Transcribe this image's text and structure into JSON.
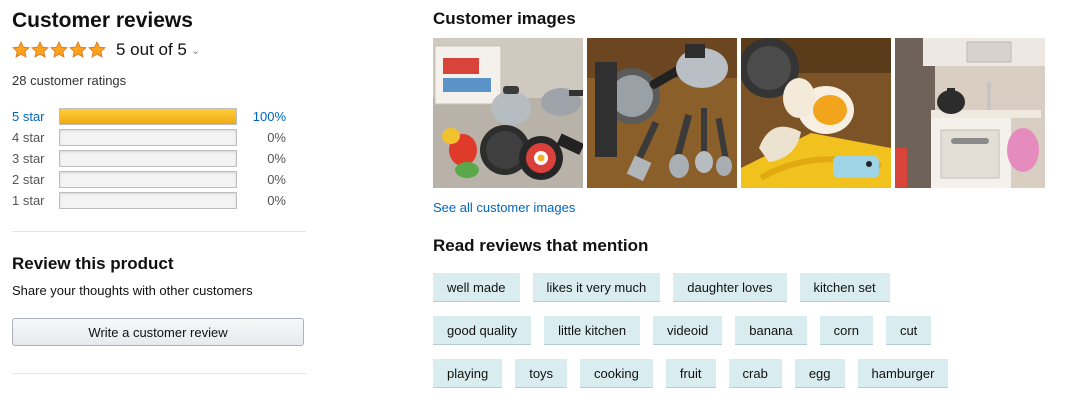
{
  "reviews": {
    "title": "Customer reviews",
    "rating_value": 5,
    "rating_text": "5 out of 5",
    "total_ratings": "28 customer ratings",
    "histogram": [
      {
        "label": "5 star",
        "percent_text": "100%",
        "percent": 100
      },
      {
        "label": "4 star",
        "percent_text": "0%",
        "percent": 0
      },
      {
        "label": "3 star",
        "percent_text": "0%",
        "percent": 0
      },
      {
        "label": "2 star",
        "percent_text": "0%",
        "percent": 0
      },
      {
        "label": "1 star",
        "percent_text": "0%",
        "percent": 0
      }
    ]
  },
  "review_product": {
    "title": "Review this product",
    "subtitle": "Share your thoughts with other customers",
    "button_label": "Write a customer review"
  },
  "customer_images": {
    "title": "Customer images",
    "see_all": "See all customer images",
    "images": [
      "toy-cookware-set-photo",
      "toy-pans-utensils-photo",
      "toy-egg-food-photo",
      "play-kitchen-photo"
    ]
  },
  "mentions": {
    "title": "Read reviews that mention",
    "rows": [
      [
        "well made",
        "likes it very much",
        "daughter loves",
        "kitchen set"
      ],
      [
        "good quality",
        "little kitchen",
        "videoid",
        "banana",
        "corn",
        "cut"
      ],
      [
        "playing",
        "toys",
        "cooking",
        "fruit",
        "crab",
        "egg",
        "hamburger"
      ]
    ]
  },
  "colors": {
    "star": "#ffa41c",
    "bar_fill": "#f0a913",
    "link": "#0066c0",
    "chip_bg": "#d9ecf0"
  }
}
